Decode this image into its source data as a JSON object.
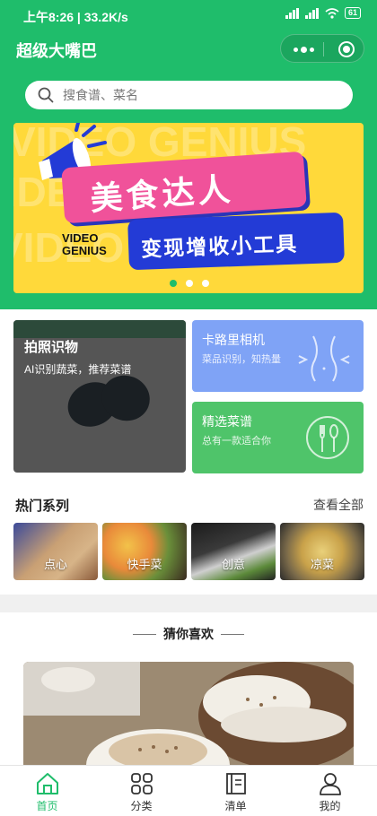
{
  "status_bar": {
    "time": "上午8:26",
    "speed": "33.2K/s",
    "battery": "61"
  },
  "header": {
    "title": "超级大嘴巴"
  },
  "search": {
    "placeholder": "搜食谱、菜名"
  },
  "banner": {
    "headline": "美食达人",
    "subline": "变现增收小工具",
    "brand_line1": "VIDEO",
    "brand_line2": "GENIUS",
    "background_words": [
      "VIDEO GENIUS",
      "VIDEO GENIUS",
      "VIDEO GENIUS"
    ]
  },
  "cards": {
    "photo": {
      "title": "拍照识物",
      "subtitle": "AI识别蔬菜，推荐菜谱"
    },
    "camera": {
      "title": "卡路里相机",
      "subtitle": "菜品识别，知热量"
    },
    "recipes": {
      "title": "精选菜谱",
      "subtitle": "总有一款适合你"
    }
  },
  "series": {
    "heading": "热门系列",
    "more": "查看全部",
    "tiles": [
      {
        "label": "点心"
      },
      {
        "label": "快手菜"
      },
      {
        "label": "创意"
      },
      {
        "label": "凉菜"
      }
    ]
  },
  "guess": {
    "title": "猜你喜欢"
  },
  "tabbar": {
    "tabs": [
      {
        "label": "首页",
        "icon": "home-icon",
        "active": true
      },
      {
        "label": "分类",
        "icon": "grid-icon",
        "active": false
      },
      {
        "label": "清单",
        "icon": "list-icon",
        "active": false
      },
      {
        "label": "我的",
        "icon": "user-icon",
        "active": false
      }
    ]
  },
  "colors": {
    "brand_green": "#1fbd6b",
    "banner_yellow": "#ffd93a",
    "card_blue": "#7fa3f6",
    "card_green": "#4fc46a"
  }
}
